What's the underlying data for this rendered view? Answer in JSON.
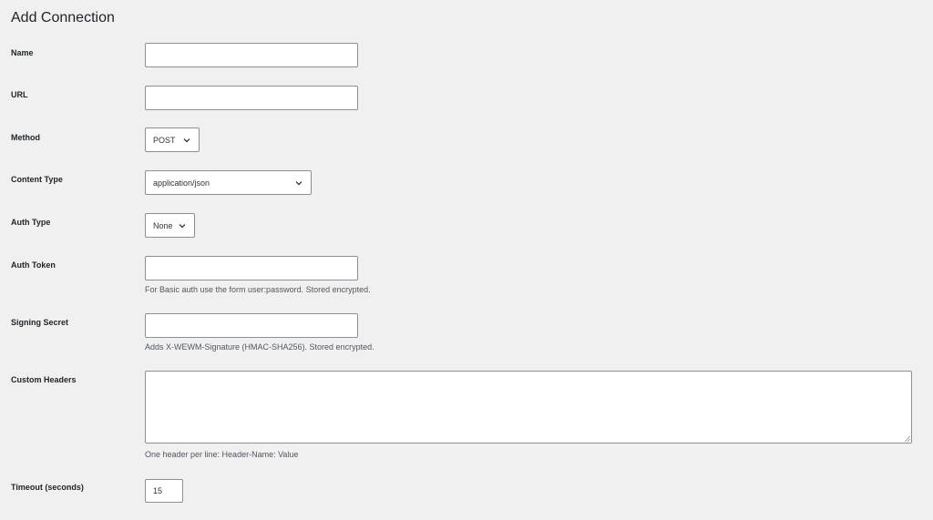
{
  "page": {
    "title": "Add Connection"
  },
  "form": {
    "name": {
      "label": "Name",
      "value": ""
    },
    "url": {
      "label": "URL",
      "value": ""
    },
    "method": {
      "label": "Method",
      "selected": "POST"
    },
    "content_type": {
      "label": "Content Type",
      "selected": "application/json"
    },
    "auth_type": {
      "label": "Auth Type",
      "selected": "None"
    },
    "auth_token": {
      "label": "Auth Token",
      "value": "",
      "help": "For Basic auth use the form user:password. Stored encrypted."
    },
    "signing_secret": {
      "label": "Signing Secret",
      "value": "",
      "help": "Adds X-WEWM-Signature (HMAC-SHA256). Stored encrypted."
    },
    "custom_headers": {
      "label": "Custom Headers",
      "value": "",
      "help": "One header per line: Header-Name: Value"
    },
    "timeout": {
      "label": "Timeout (seconds)",
      "value": "15"
    }
  },
  "icons": {
    "select_arrow": "chevron-down-icon",
    "textarea_resize": "resize-handle-icon"
  },
  "colors": {
    "background": "#f0f0f1",
    "field_border": "#8c8f94",
    "text": "#1d2327",
    "help_text": "#50575e"
  }
}
